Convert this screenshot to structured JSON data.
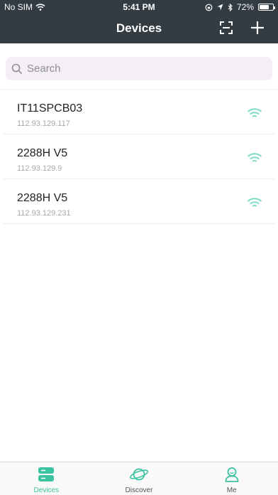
{
  "status_bar": {
    "carrier": "No SIM",
    "time": "5:41 PM",
    "battery": "72%",
    "battery_level": 0.72
  },
  "header": {
    "title": "Devices",
    "scan_icon": "scan-icon",
    "add_icon": "plus-icon"
  },
  "search": {
    "placeholder": "Search",
    "value": ""
  },
  "devices": [
    {
      "name": "IT11SPCB03",
      "ip": "112.93.129.117",
      "status_icon": "wifi-icon"
    },
    {
      "name": "2288H V5",
      "ip": "112.93.129.9",
      "status_icon": "wifi-icon"
    },
    {
      "name": "2288H V5",
      "ip": "112.93.129.231",
      "status_icon": "wifi-icon"
    }
  ],
  "tabbar": {
    "tabs": [
      {
        "label": "Devices",
        "icon": "server-icon",
        "active": true
      },
      {
        "label": "Discover",
        "icon": "planet-icon",
        "active": false
      },
      {
        "label": "Me",
        "icon": "person-icon",
        "active": false
      }
    ]
  },
  "colors": {
    "header_bg": "#333b43",
    "accent": "#3cc4a2",
    "search_bg": "#f3eff4"
  }
}
